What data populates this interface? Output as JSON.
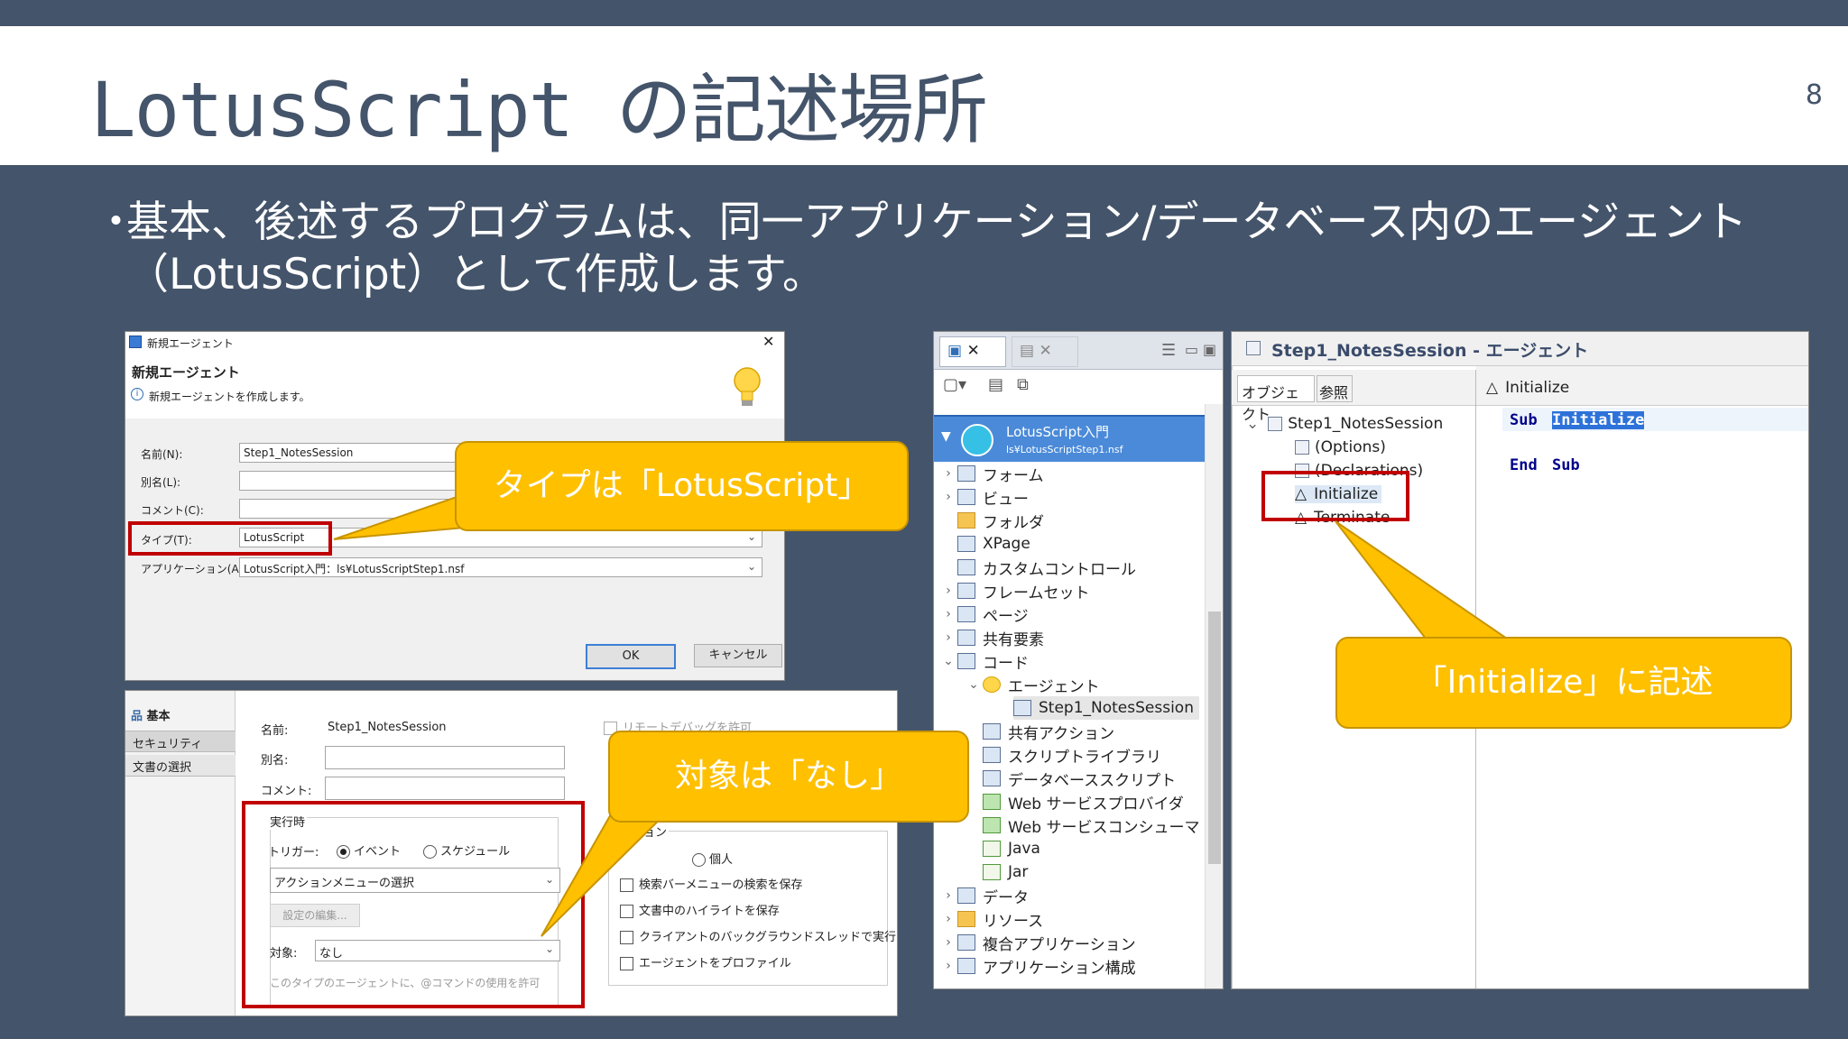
{
  "slide": {
    "title": "LotusScript の記述場所",
    "page_number": "8",
    "bullet_dot": "・",
    "bullet": "基本、後述するプログラムは、同一アプリケーション/データベース内のエージェント（LotusScript）として作成します。"
  },
  "new_agent_dialog": {
    "window_title": "新規エージェント",
    "heading": "新規エージェント",
    "info": "新規エージェントを作成します。",
    "close_glyph": "✕",
    "bulb_icon": "lightbulb-icon",
    "fields": {
      "name_label": "名前(N):",
      "name_value": "Step1_NotesSession",
      "alias_label": "別名(L):",
      "comment_label": "コメント(C):",
      "type_label": "タイプ(T):",
      "type_value": "LotusScript",
      "app_label": "アプリケーション(A):",
      "app_value": "LotusScript入門：ls¥LotusScriptStep1.nsf"
    },
    "ok_label": "OK",
    "cancel_label": "キャンセル"
  },
  "agent_props": {
    "tabs": [
      "基本",
      "セキュリティ",
      "文書の選択"
    ],
    "name_label": "名前:",
    "name_value": "Step1_NotesSession",
    "alias_label": "別名:",
    "comment_label": "コメント:",
    "remote_debug": "リモートデバッグを許可",
    "runtime_group": "実行時",
    "trigger_label": "トリガー:",
    "trigger_event": "イベント",
    "trigger_schedule": "スケジュール",
    "action_menu": "アクションメニューの選択",
    "settings_button": "設定の編集...",
    "target_label": "対象:",
    "target_value": "なし",
    "atcommand_note": "このタイプのエージェントに、@コマンドの使用を許可",
    "options_group": "オプション",
    "personal_label": "個人",
    "options": [
      "検索バーメニューの検索を保存",
      "文書中のハイライトを保存",
      "クライアントのバックグラウンドスレッドで実行",
      "エージェントをプロファイル"
    ]
  },
  "navigator": {
    "app_name": "LotusScript入門",
    "app_path": "ls¥LotusScriptStep1.nsf",
    "items": [
      {
        "label": "フォーム",
        "icon": "form-icon"
      },
      {
        "label": "ビュー",
        "icon": "view-icon"
      },
      {
        "label": "フォルダ",
        "icon": "folder-icon"
      },
      {
        "label": "XPage",
        "icon": "xpage-icon"
      },
      {
        "label": "カスタムコントロール",
        "icon": "custom-control-icon"
      },
      {
        "label": "フレームセット",
        "icon": "frameset-icon"
      },
      {
        "label": "ページ",
        "icon": "page-icon"
      },
      {
        "label": "共有要素",
        "icon": "shared-element-icon"
      },
      {
        "label": "コード",
        "icon": "code-icon"
      },
      {
        "label": "エージェント",
        "icon": "agent-icon"
      },
      {
        "label": "Step1_NotesSession",
        "icon": "agent-item-icon"
      },
      {
        "label": "共有アクション",
        "icon": "shared-action-icon"
      },
      {
        "label": "スクリプトライブラリ",
        "icon": "script-library-icon"
      },
      {
        "label": "データベーススクリプト",
        "icon": "database-script-icon"
      },
      {
        "label": "Web サービスプロバイダ",
        "icon": "web-service-provider-icon"
      },
      {
        "label": "Web サービスコンシューマ",
        "icon": "web-service-consumer-icon"
      },
      {
        "label": "Java",
        "icon": "java-icon"
      },
      {
        "label": "Jar",
        "icon": "jar-icon"
      },
      {
        "label": "データ",
        "icon": "data-icon"
      },
      {
        "label": "リソース",
        "icon": "resource-icon"
      },
      {
        "label": "複合アプリケーション",
        "icon": "composite-app-icon"
      },
      {
        "label": "アプリケーション構成",
        "icon": "app-config-icon"
      }
    ]
  },
  "editor": {
    "title": "Step1_NotesSession - エージェント",
    "tab_objects": "オブジェクト",
    "tab_reference": "参照",
    "tree_root": "Step1_NotesSession",
    "tree_items": [
      "(Options)",
      "(Declarations)",
      "Initialize",
      "Terminate"
    ],
    "current_event": "Initialize",
    "code_kw_sub": "Sub",
    "code_name": "Initialize",
    "code_kw_end": "End",
    "code_kw_sub2": "Sub"
  },
  "callouts": {
    "type": "タイプは「LotusScript」",
    "target": "対象は「なし」",
    "initialize": "「Initialize」に記述"
  },
  "colors": {
    "slide_bg": "#44546a",
    "callout": "#ffc000",
    "highlight_border": "#c00000",
    "keyword": "#00008b"
  }
}
